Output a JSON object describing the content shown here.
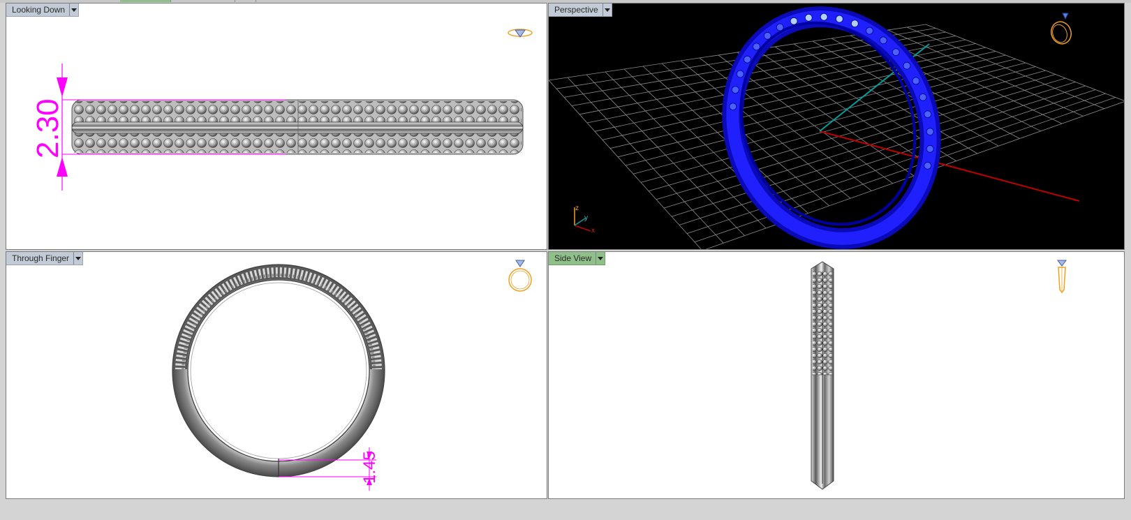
{
  "viewports": {
    "top_left": {
      "label": "Looking Down",
      "dimension": "2.30",
      "icon": "diamond-ring-icon"
    },
    "top_right": {
      "label": "Perspective",
      "icon": "ring-3d-icon",
      "axes": {
        "z": "z",
        "y": "y",
        "x": "x"
      }
    },
    "bottom_left": {
      "label": "Through Finger",
      "dimension": "1.45",
      "icon": "ring-front-icon"
    },
    "bottom_right": {
      "label": "Side View",
      "icon": "ring-side-icon",
      "active": true
    }
  },
  "colors": {
    "dimension": "#ff00ff",
    "ring_perspective": "#1010e0",
    "icon": "#f0a020",
    "grid": "#8c8c8c",
    "x_axis": "#c00000",
    "y_axis": "#00a0a0",
    "active_label": "#8fc08a"
  }
}
